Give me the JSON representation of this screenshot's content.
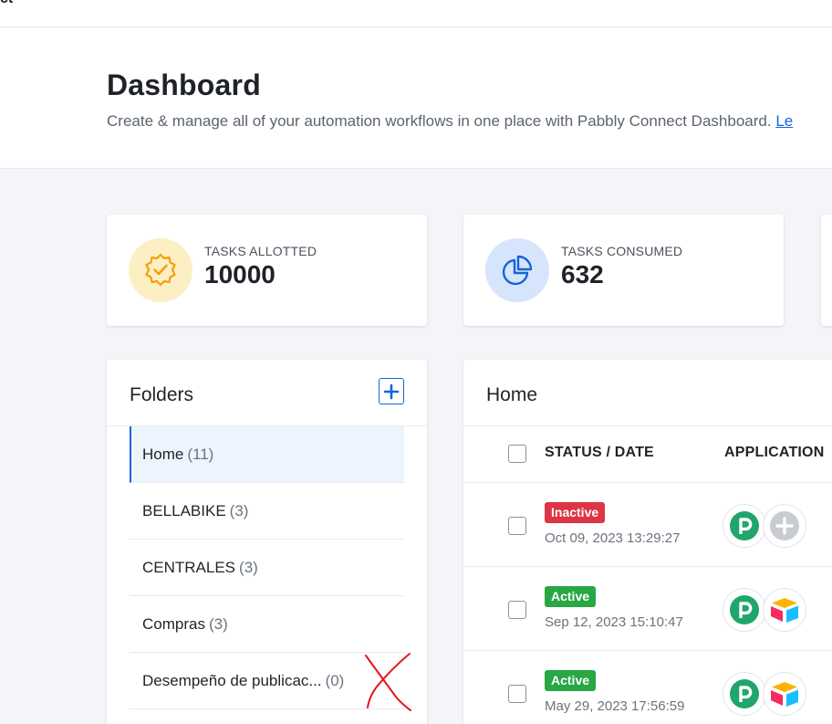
{
  "topbar": {
    "fragment": "ct"
  },
  "header": {
    "title": "Dashboard",
    "subtitle": "Create & manage all of your automation workflows in one place with Pabbly Connect Dashboard.",
    "learn_more_fragment": "Le"
  },
  "stats": [
    {
      "label": "TASKS ALLOTTED",
      "value": "10000",
      "icon": "badge-check-icon",
      "icon_bg": "#fdefc4",
      "icon_color": "#f0a20b"
    },
    {
      "label": "TASKS CONSUMED",
      "value": "632",
      "icon": "pie-chart-icon",
      "icon_bg": "#d6e5fb",
      "icon_color": "#1565d8"
    }
  ],
  "folders": {
    "title": "Folders",
    "add_button_label": "+",
    "items": [
      {
        "name": "Home",
        "count": "(11)",
        "active": true
      },
      {
        "name": "BELLABIKE",
        "count": "(3)"
      },
      {
        "name": "CENTRALES",
        "count": "(3)"
      },
      {
        "name": "Compras",
        "count": "(3)"
      },
      {
        "name": "Desempeño de publicac...",
        "count": "(0)"
      }
    ]
  },
  "workflows": {
    "title": "Home",
    "columns": [
      "STATUS / DATE",
      "APPLICATION"
    ],
    "rows": [
      {
        "status": "Inactive",
        "date": "Oct 09, 2023 13:29:27",
        "apps": [
          "pabbly-icon",
          "add-app-icon"
        ]
      },
      {
        "status": "Active",
        "date": "Sep 12, 2023 15:10:47",
        "apps": [
          "pabbly-icon",
          "airtable-icon"
        ]
      },
      {
        "status": "Active",
        "date": "May 29, 2023 17:56:59",
        "apps": [
          "pabbly-icon",
          "airtable-icon"
        ]
      }
    ]
  },
  "colors": {
    "accent": "#1565d8",
    "inactive": "#dc3545",
    "active": "#28a745",
    "pabbly_green": "#20a56b",
    "annotation_red": "#e8141c"
  }
}
